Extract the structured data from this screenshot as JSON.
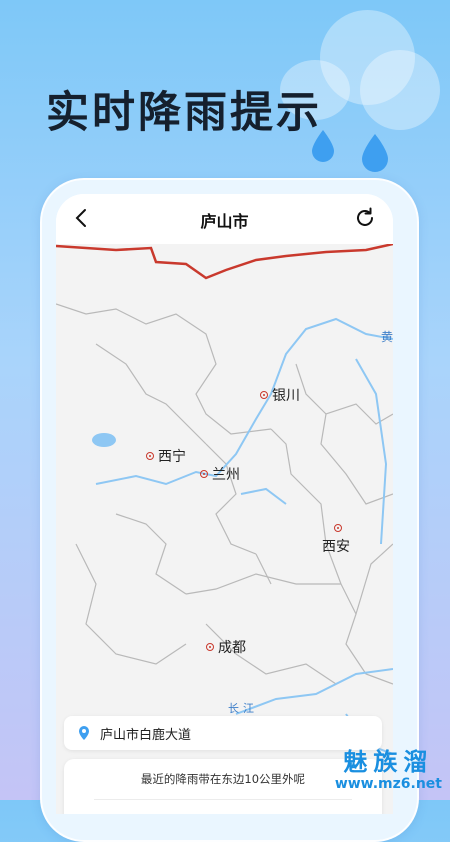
{
  "headline": "实时降雨提示",
  "app": {
    "title": "庐山市",
    "back_icon": "chevron-left-icon",
    "refresh_icon": "refresh-icon"
  },
  "map": {
    "cities": [
      {
        "key": "yinchuan",
        "name": "银川"
      },
      {
        "key": "xining",
        "name": "西宁"
      },
      {
        "key": "lanzhou",
        "name": "兰州"
      },
      {
        "key": "xian",
        "name": "西安"
      },
      {
        "key": "chengdu",
        "name": "成都"
      }
    ],
    "river_label": "长江",
    "edge_label": "黄",
    "colors": {
      "border": "#c9392d",
      "river": "#8ec7f3",
      "land": "#f3f3f3",
      "province_line": "#b9b9b9"
    }
  },
  "location": {
    "address": "庐山市白鹿大道",
    "pin_icon": "location-pin-icon"
  },
  "rain_card": {
    "message": "最近的降雨带在东边10公里外呢"
  },
  "watermark": {
    "title": "魅族溜",
    "url": "www.mz6.net"
  }
}
